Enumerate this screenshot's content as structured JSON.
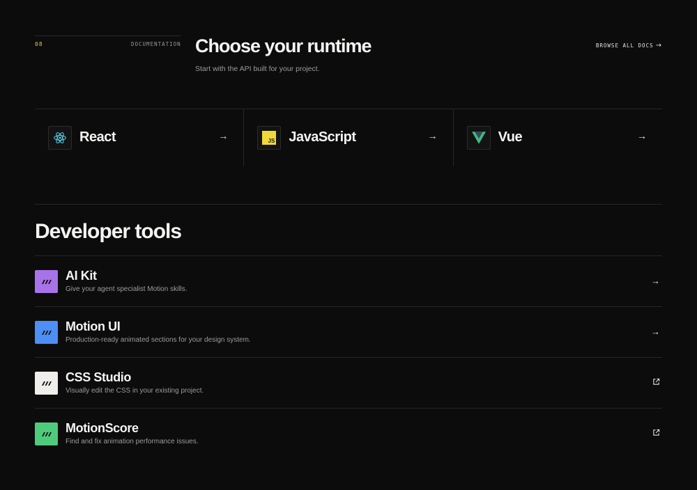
{
  "section": {
    "number": "08",
    "label": "DOCUMENTATION",
    "title": "Choose your runtime",
    "subtitle": "Start with the API built for your project.",
    "browse_label": "BROWSE ALL DOCS",
    "browse_arrow": "→"
  },
  "runtimes": [
    {
      "name": "React",
      "icon": "react-icon",
      "arrow": "→"
    },
    {
      "name": "JavaScript",
      "icon": "javascript-icon",
      "icon_text": "JS",
      "arrow": "→"
    },
    {
      "name": "Vue",
      "icon": "vue-icon",
      "arrow": "→"
    }
  ],
  "tools": {
    "title": "Developer tools",
    "items": [
      {
        "name": "AI Kit",
        "description": "Give your agent specialist Motion skills.",
        "color": "#a873e8",
        "action": "arrow",
        "action_glyph": "→"
      },
      {
        "name": "Motion UI",
        "description": "Production-ready animated sections for your design system.",
        "color": "#4d8ef7",
        "action": "arrow",
        "action_glyph": "→"
      },
      {
        "name": "CSS Studio",
        "description": "Visually edit the CSS in your existing project.",
        "color": "#efeeea",
        "action": "external-link",
        "action_glyph": "↗"
      },
      {
        "name": "MotionScore",
        "description": "Find and fix animation performance issues.",
        "color": "#4fcb7e",
        "action": "external-link",
        "action_glyph": "↗"
      }
    ]
  },
  "colors": {
    "background": "#0b0c0b",
    "accent_number": "#e8c547",
    "react": "#5fd2f0",
    "vue_outer": "#42b883",
    "vue_inner": "#35495e",
    "js_bg": "#f0d83a"
  }
}
